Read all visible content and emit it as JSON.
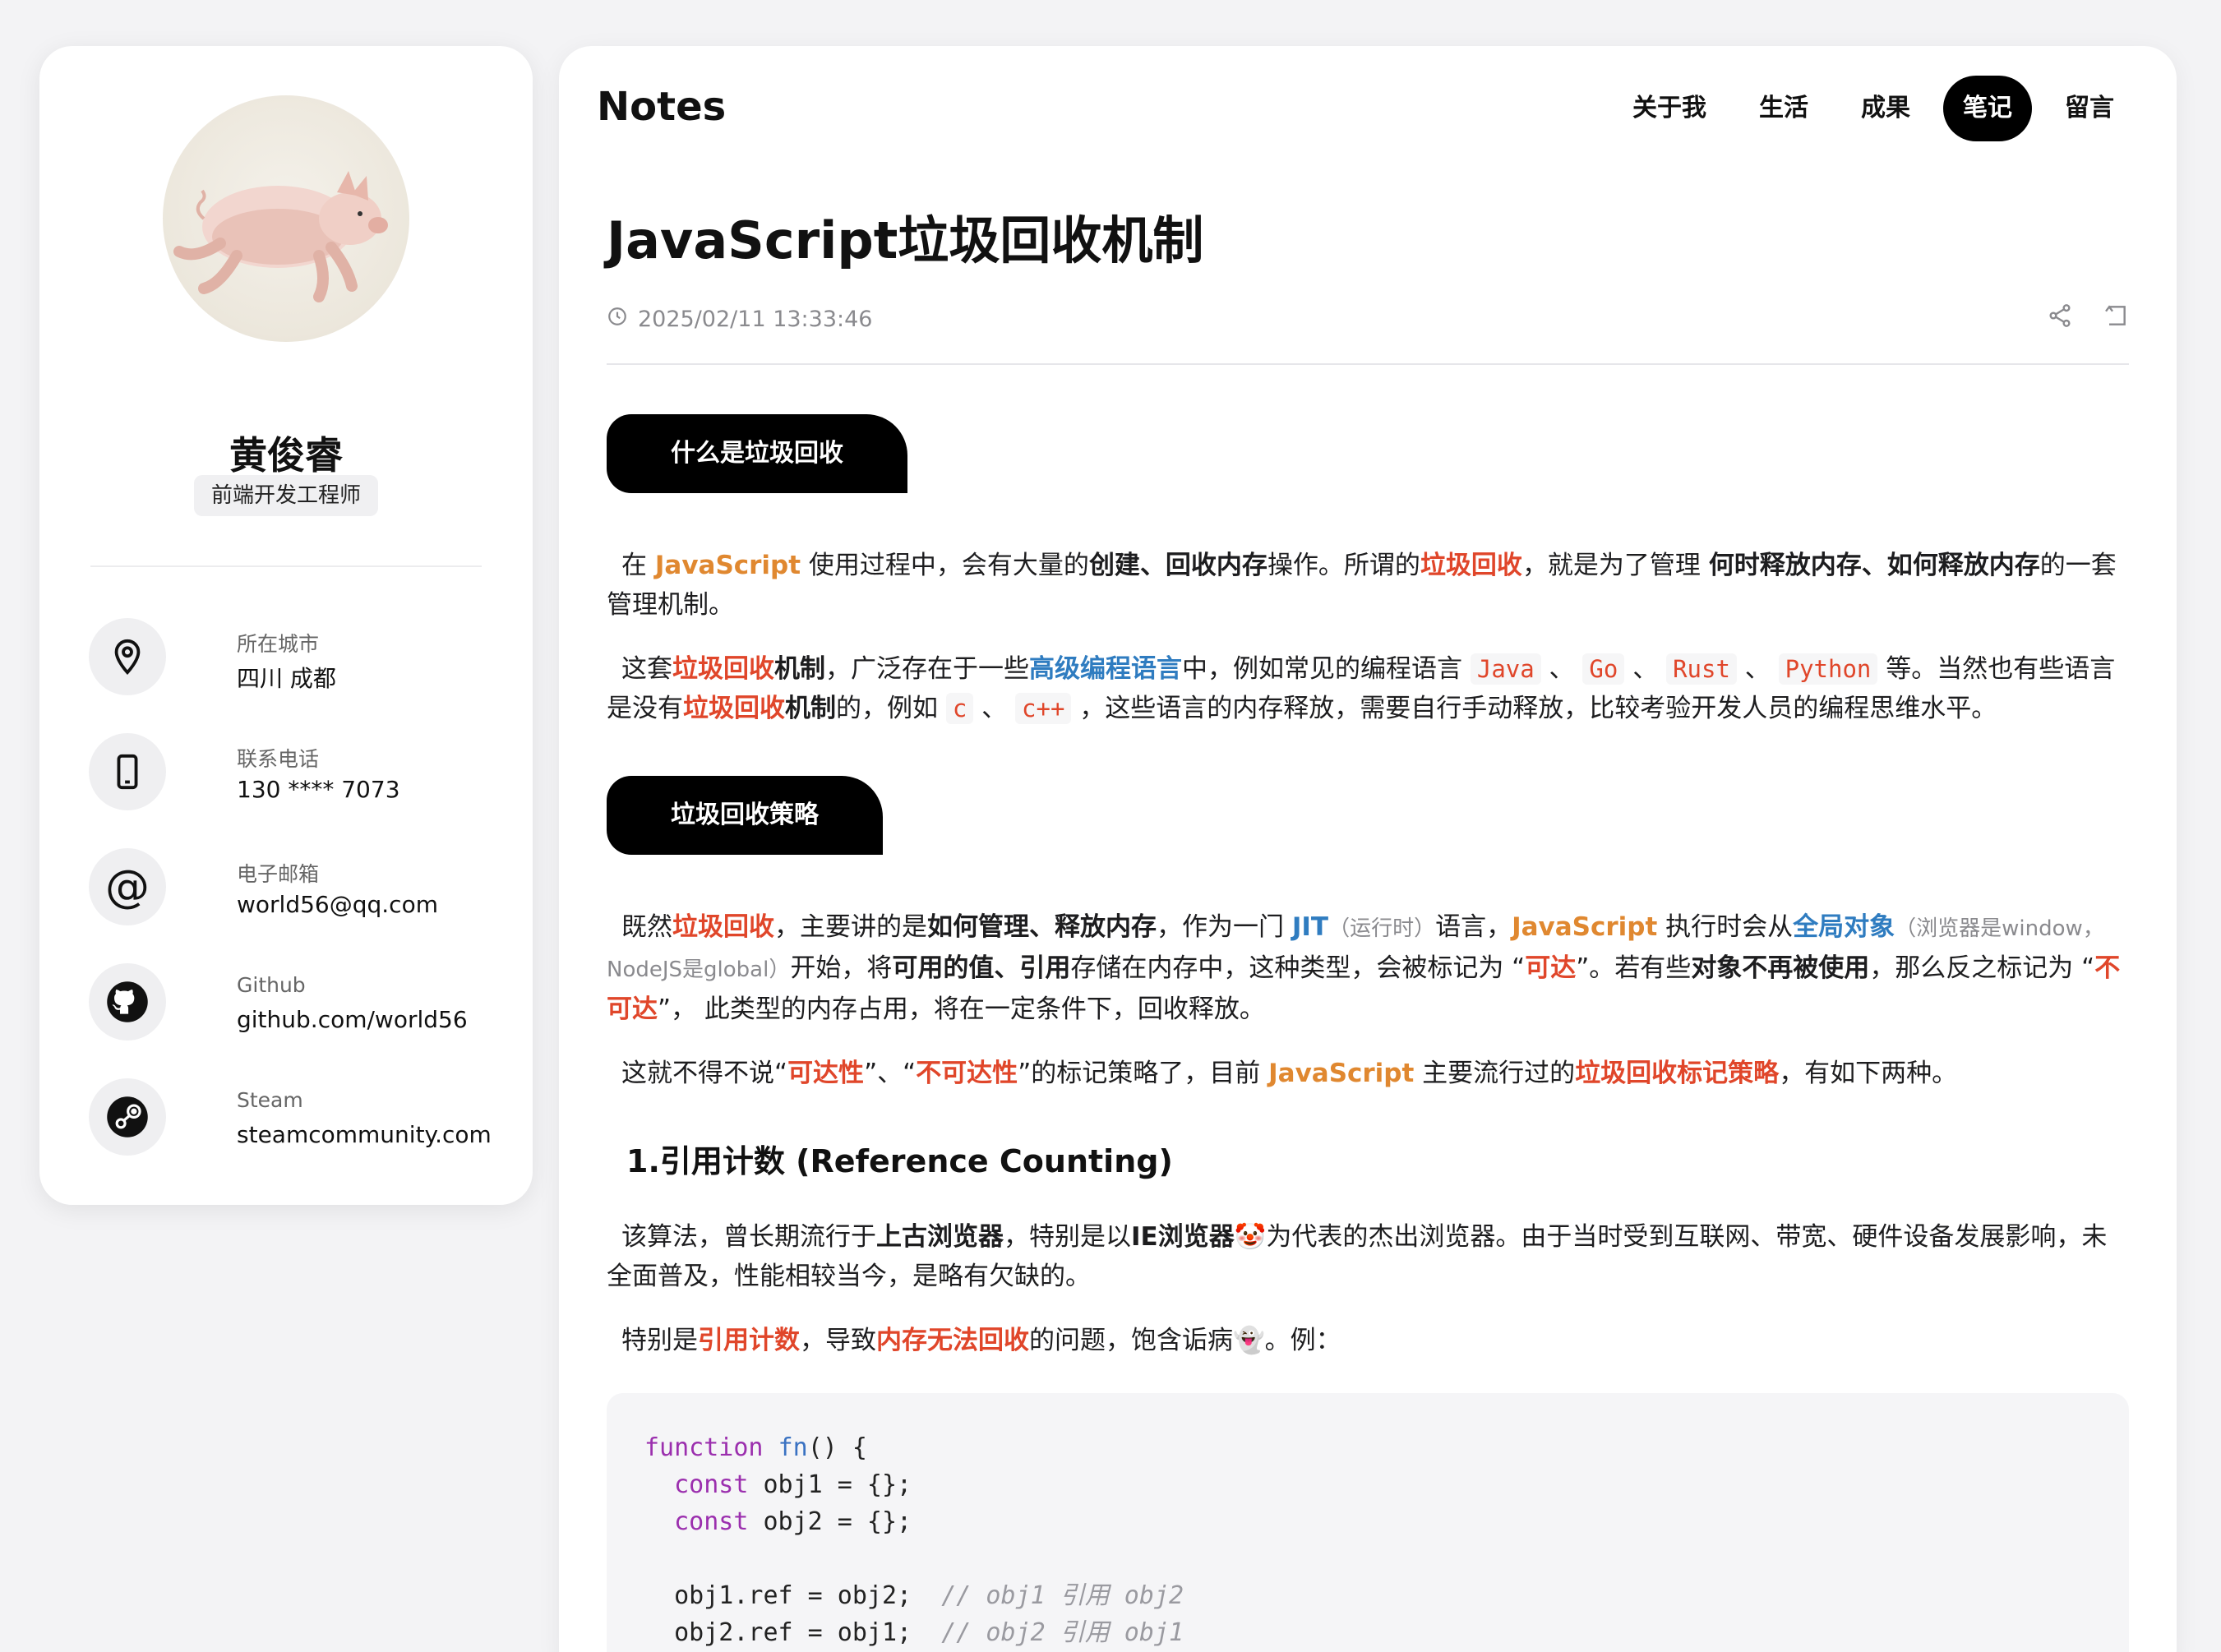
{
  "profile": {
    "name": "黄俊睿",
    "role": "前端开发工程师",
    "contacts": [
      {
        "label": "所在城市",
        "value": "四川 成都",
        "icon": "location-pin-icon"
      },
      {
        "label": "联系电话",
        "value": "130 **** 7073",
        "icon": "phone-icon"
      },
      {
        "label": "电子邮箱",
        "value": "world56@qq.com",
        "icon": "at-sign-icon"
      },
      {
        "label": "Github",
        "value": "github.com/world56",
        "icon": "github-icon"
      },
      {
        "label": "Steam",
        "value": "steamcommunity.com",
        "icon": "steam-icon"
      }
    ]
  },
  "header": {
    "brand": "Notes",
    "nav": [
      "关于我",
      "生活",
      "成果",
      "笔记",
      "留言"
    ],
    "active_nav": "笔记"
  },
  "article": {
    "title": "JavaScript垃圾回收机制",
    "date": "2025/02/11 13:33:46",
    "section1": "什么是垃圾回收",
    "section2": "垃圾回收策略",
    "subheading1": "1.引用计数 (Reference Counting)",
    "p1": {
      "a": "在 ",
      "js": "JavaScript",
      "b": " 使用过程中，会有大量的",
      "c": "创建、回收内存",
      "d": "操作。所谓的",
      "e": "垃圾回收",
      "f": "，就是为了管理 ",
      "g": "何时释放内存、如何释放内存",
      "h": "的一套管理机制。"
    },
    "p2": {
      "a": "这套",
      "b": "垃圾回收",
      "c": "机制",
      "d": "，广泛存在于一些",
      "e": "高级编程语言",
      "f": "中，例如常见的编程语言 ",
      "java": "Java",
      "go": "Go",
      "rust": "Rust",
      "python": "Python",
      "sep": " 、 ",
      "g": " 等。当然也有些语言是没有",
      "h": "垃圾回收",
      "i": "机制",
      "j": "的，例如 ",
      "c_lang": "c",
      "cpp": "c++",
      "k": " ，这些语言的内存释放，需要自行手动释放，比较考验开发人员的编程思维水平。"
    },
    "p3": {
      "a": "既然",
      "b": "垃圾回收",
      "c": "，主要讲的是",
      "d": "如何管理、释放内存",
      "e": "，作为一门 ",
      "jit": "JIT",
      "f": "（运行时）",
      "g": "语言，",
      "js": "JavaScript",
      "h": " 执行时会从",
      "i": "全局对象",
      "j": "（浏览器是window，NodeJS是global）",
      "k": "开始，将",
      "l": "可用的值、引用",
      "m": "存储在内存中，这种类型，会被标记为 “",
      "n": "可达",
      "o": "”。若有些",
      "p": "对象不再被使用",
      "q": "，那么反之标记为 “",
      "r": "不可达",
      "s": "”， 此类型的内存占用，将在一定条件下，回收释放。"
    },
    "p4": {
      "a": "这就不得不说“",
      "b": "可达性",
      "c": "”、“",
      "d": "不可达性",
      "e": "”的标记策略了，目前 ",
      "js": "JavaScript",
      "f": " 主要流行过的",
      "g": "垃圾回收标记策略",
      "h": "，有如下两种。"
    },
    "p5": {
      "a": "该算法，曾长期流行于",
      "b": "上古浏览器",
      "c": "，特别是以",
      "d": "IE浏览器",
      "emoji": "🤡",
      "e": "为代表的杰出浏览器。由于当时受到互联网、带宽、硬件设备发展影响，未全面普及，性能相较当今，是略有欠缺的。"
    },
    "p6": {
      "a": "特别是",
      "b": "引用计数",
      "c": "，导致",
      "d": "内存无法回收",
      "e": "的问题，饱含诟病",
      "emoji": "👻",
      "f": "。例："
    },
    "code": {
      "l1_kw": "function",
      "l1_fn": "fn",
      "l1_rest": "() {",
      "l2_kw": "const",
      "l2_rest": " obj1 = {};",
      "l3_kw": "const",
      "l3_rest": " obj2 = {};",
      "l5": "obj1.ref = obj2;",
      "l5_cm": "// obj1 引用 obj2",
      "l6": "obj2.ref = obj1;",
      "l6_cm": "// obj2 引用 obj1"
    }
  }
}
